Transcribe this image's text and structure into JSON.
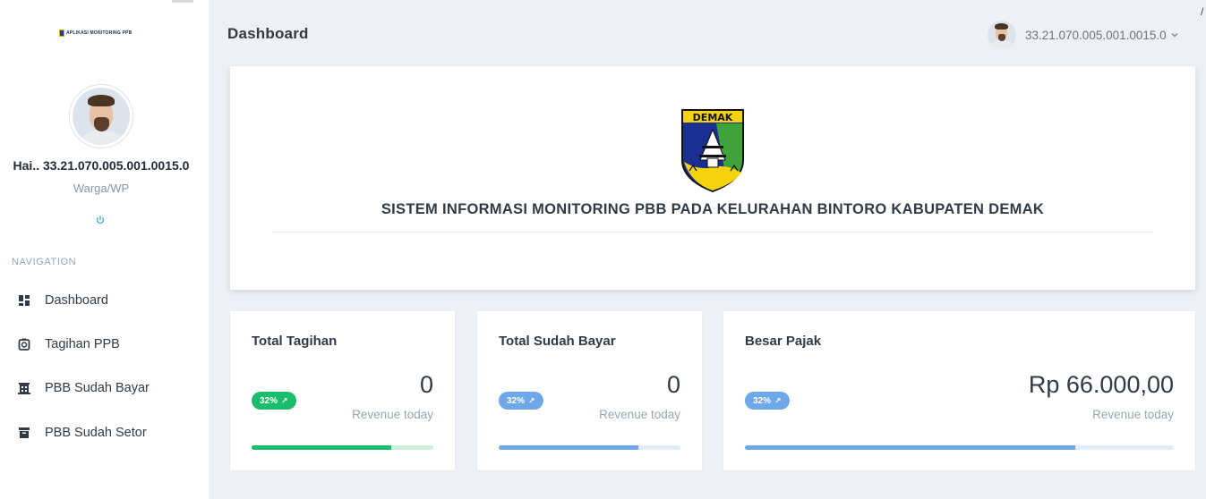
{
  "app": {
    "logo_text": "APLIKASI MONITORING PPB"
  },
  "sidebar": {
    "user_name": "Hai.. 33.21.070.005.001.0015.0",
    "user_role": "Warga/WP",
    "nav_title": "NAVIGATION",
    "items": [
      {
        "label": "Dashboard",
        "icon": "dashboard-icon"
      },
      {
        "label": "Tagihan PPB",
        "icon": "timer-icon"
      },
      {
        "label": "PBB Sudah Bayar",
        "icon": "building-icon"
      },
      {
        "label": "PBB Sudah Setor",
        "icon": "archive-icon"
      }
    ]
  },
  "header": {
    "title": "Dashboard",
    "user_label": "33.21.070.005.001.0015.0"
  },
  "hero": {
    "crest_text": "DEMAK",
    "title": "SISTEM INFORMASI MONITORING PBB PADA KELURAHAN BINTORO KABUPATEN DEMAK"
  },
  "stats": [
    {
      "title": "Total Tagihan",
      "value": "0",
      "subtitle": "Revenue today",
      "badge": "32%",
      "progress": 0.77,
      "color": "#1bbc6b",
      "track": "#cdeedd"
    },
    {
      "title": "Total Sudah Bayar",
      "value": "0",
      "subtitle": "Revenue today",
      "badge": "32%",
      "progress": 0.77,
      "color": "#6ea8e8",
      "track": "#e1eefa"
    },
    {
      "title": "Besar Pajak",
      "value": "Rp 66.000,00",
      "subtitle": "Revenue today",
      "badge": "32%",
      "progress": 0.77,
      "color": "#6ea8e8",
      "track": "#e1eefa"
    }
  ]
}
